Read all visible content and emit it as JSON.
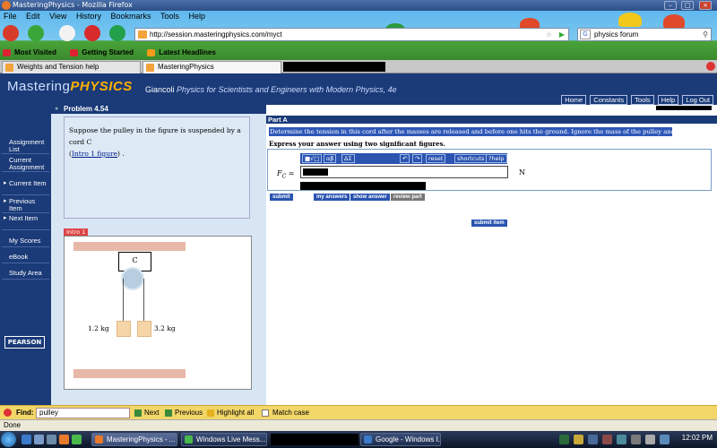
{
  "window": {
    "title": "MasteringPhysics - Mozilla Firefox"
  },
  "menu": [
    "File",
    "Edit",
    "View",
    "History",
    "Bookmarks",
    "Tools",
    "Help"
  ],
  "navigation": {
    "url": "http://session.masteringphysics.com/myct",
    "search_value": "physics forum",
    "search_engine_icon": "G"
  },
  "bookmarks": [
    "Most Visited",
    "Getting Started",
    "Latest Headlines"
  ],
  "tabs": [
    {
      "label": "Weights and Tension help",
      "active": false
    },
    {
      "label": "MasteringPhysics",
      "active": true
    }
  ],
  "site": {
    "logo_a": "Mastering",
    "logo_b": "PHYSICS",
    "book_author": "Giancoli",
    "book_title": "Physics for Scientists and Engineers with Modern Physics, 4e",
    "links": [
      "Home",
      "Constants",
      "Tools",
      "Help",
      "Log Out"
    ]
  },
  "sidebar": {
    "items": [
      {
        "label": "Assignment List"
      },
      {
        "label": "Current Assignment"
      },
      {
        "label": "Current Item"
      },
      {
        "label": "Previous Item"
      },
      {
        "label": "Next Item"
      },
      {
        "label": "My Scores"
      },
      {
        "label": "eBook"
      },
      {
        "label": "Study Area"
      }
    ],
    "pearson": "PEARSON"
  },
  "problem": {
    "title": "Problem 4.54",
    "text_before": "Suppose the pulley in the figure is suspended by a cord ",
    "cord_var": "C",
    "link": "Intro 1 figure",
    "text_after": ".",
    "intro_tab": "Intro 1",
    "figure": {
      "box_label": "C",
      "mass_left": "1.2 kg",
      "mass_right": "3.2 kg"
    }
  },
  "part": {
    "title": "Part A",
    "question": "Determine the tension in this cord after the masses are released and before one hits the ground. Ignore the mass of the pulley and cords.",
    "instruction": "Express your answer using two significant figures.",
    "answer_label": "F",
    "answer_sub": "C",
    "answer_eq": "=",
    "unit": "N",
    "toolbar": [
      "■√□",
      "αβ",
      "ΔΣ",
      "↶",
      "↷",
      "reset",
      "shortcuts",
      "?help"
    ],
    "buttons": {
      "submit": "submit",
      "my_answers": "my answers",
      "show_answer": "show answer",
      "review_part": "review part",
      "submit_item": "submit item"
    }
  },
  "findbar": {
    "label": "Find:",
    "value": "pulley",
    "next": "Next",
    "previous": "Previous",
    "highlight": "Highlight all",
    "match_case": "Match case"
  },
  "status": {
    "text": "Done"
  },
  "taskbar": {
    "tasks": [
      "MasteringPhysics - ...",
      "Windows Live Mess...",
      "Google - Windows I..."
    ],
    "clock": "12:02 PM"
  }
}
